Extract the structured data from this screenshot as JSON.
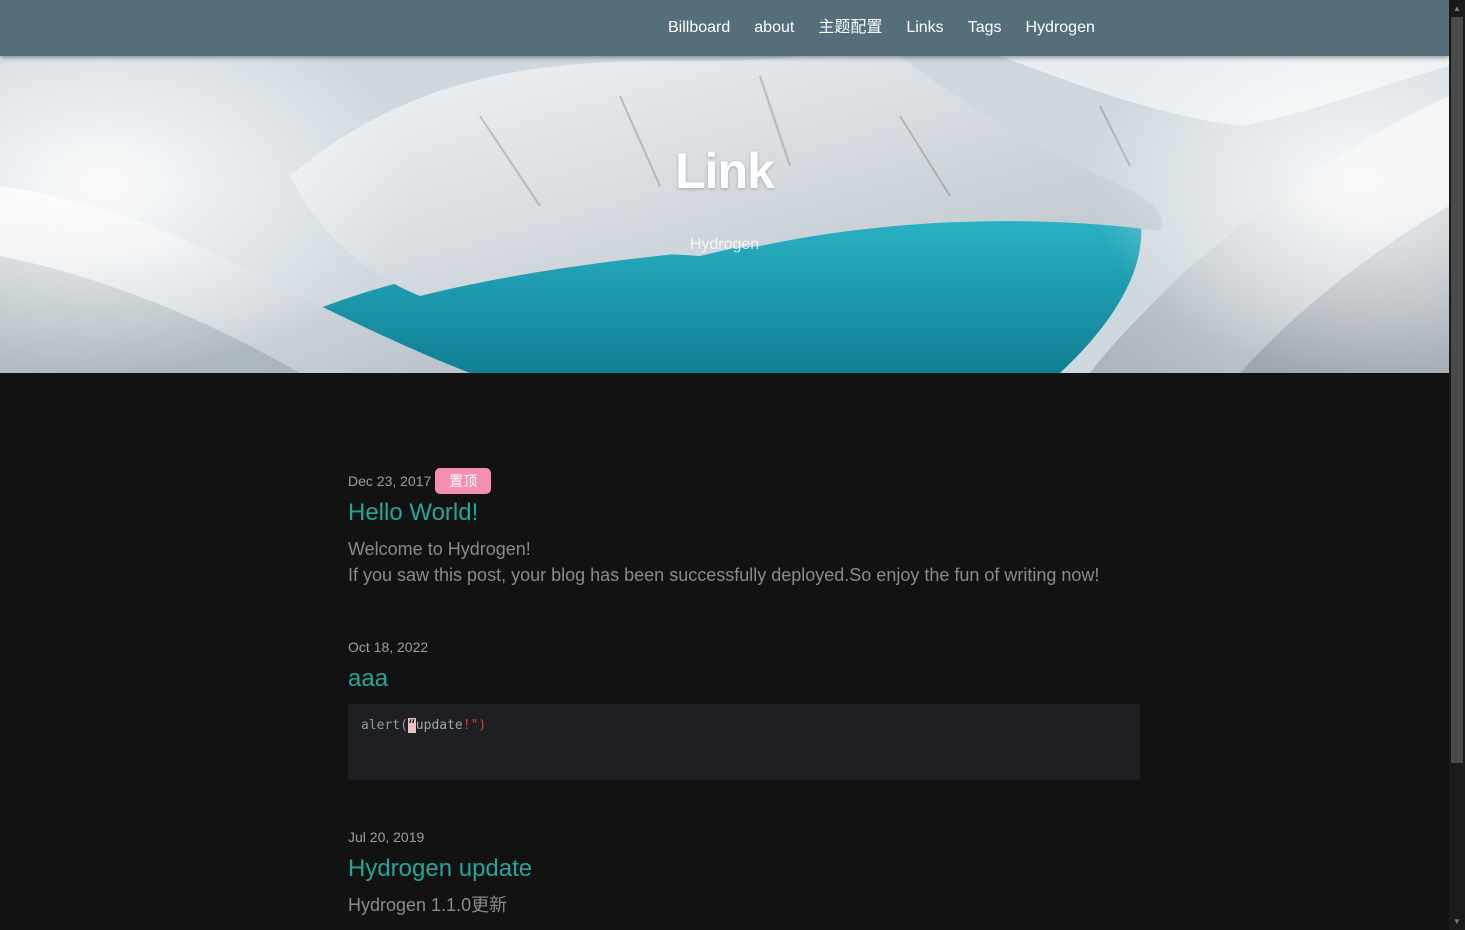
{
  "nav": {
    "items": [
      {
        "label": "Billboard"
      },
      {
        "label": "about"
      },
      {
        "label": "主题配置"
      },
      {
        "label": "Links"
      },
      {
        "label": "Tags"
      },
      {
        "label": "Hydrogen"
      }
    ]
  },
  "banner": {
    "title": "Link",
    "subtitle": "Hydrogen"
  },
  "posts": [
    {
      "date": "Dec 23, 2017",
      "badge": "置顶",
      "title": "Hello World!",
      "excerpt_lines": [
        "Welcome to Hydrogen!",
        "If you saw this post, your blog has been successfully deployed.So enjoy the fun of writing now!"
      ]
    },
    {
      "date": "Oct 18, 2022",
      "title": "aaa",
      "code": {
        "fn": "alert(",
        "quote_open": "“",
        "text": "update",
        "bang": "!",
        "quote_close": "\"",
        "paren": ")"
      }
    },
    {
      "date": "Jul 20, 2019",
      "title": "Hydrogen update",
      "excerpt_lines": [
        "Hydrogen 1.1.0更新"
      ]
    }
  ],
  "colors": {
    "navbar": "#546e7a",
    "link": "#26a69a",
    "badge": "#f48fb1",
    "background": "#121212"
  },
  "scrollbar": {
    "up_icon": "▲",
    "down_icon": "▼"
  }
}
